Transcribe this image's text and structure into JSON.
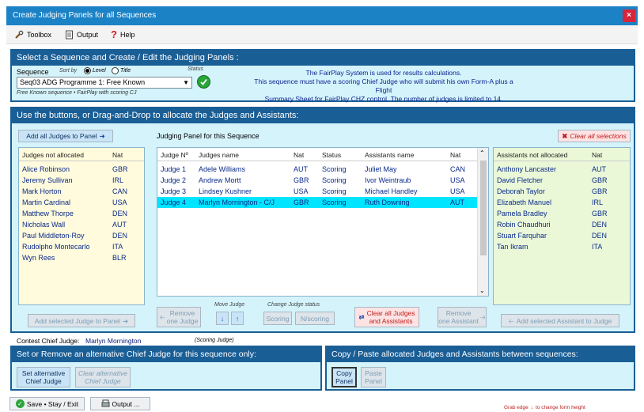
{
  "window": {
    "title": "Create Judging Panels for all Sequences",
    "close": "×"
  },
  "menu": [
    {
      "label": "Toolbox"
    },
    {
      "label": "Output"
    },
    {
      "label": "Help"
    }
  ],
  "sequence_section": {
    "title": "Select a Sequence and Create / Edit the Judging Panels :",
    "sequence_label": "Sequence",
    "sort_by": "Sort by",
    "sort_level": "Level",
    "sort_title": "Title",
    "status_label": "Status",
    "selected_sequence": "Seq03  ADG  Programme 1: Free Known",
    "note": "Free Known sequence  •  FairPlay with scoring CJ",
    "info_lines": [
      "The FairPlay System is used for results calculations.",
      "This sequence must have a scoring Chief Judge who will submit his own Form-A plus a Flight",
      "Summary Sheet for FairPlay CHZ control.  The number of judges is limited to 14."
    ]
  },
  "allocate_section": {
    "title": "Use the buttons, or Drag-and-Drop to allocate the Judges and Assistants:",
    "add_all_judges": "Add all Judges to Panel",
    "panel_title": "Judging Panel for this Sequence",
    "clear_all_selections": "Clear all selections",
    "judges_not_allocated": {
      "headers": [
        "Judges not allocated",
        "Nat"
      ],
      "rows": [
        [
          "Alice Robinson",
          "GBR"
        ],
        [
          "Jeremy Sullivan",
          "IRL"
        ],
        [
          "Mark Horton",
          "CAN"
        ],
        [
          "Martin Cardinal",
          "USA"
        ],
        [
          "Matthew Thorpe",
          "DEN"
        ],
        [
          "Nicholas Wall",
          "AUT"
        ],
        [
          "Paul Middleton-Roy",
          "DEN"
        ],
        [
          "Rudolpho Montecarlo",
          "ITA"
        ],
        [
          "Wyn Rees",
          "BLR"
        ]
      ]
    },
    "panel": {
      "headers": [
        "Judge Nº",
        "Judges name",
        "Nat",
        "Status",
        "Assistants name",
        "Nat"
      ],
      "rows": [
        [
          "Judge 1",
          "Adele Williams",
          "AUT",
          "Scoring",
          "Juliet May",
          "CAN"
        ],
        [
          "Judge 2",
          "Andrew Mortt",
          "GBR",
          "Scoring",
          "Ivor Weintraub",
          "USA"
        ],
        [
          "Judge 3",
          "Lindsey Kushner",
          "USA",
          "Scoring",
          "Michael Handley",
          "USA"
        ],
        [
          "Judge 4",
          "Marlyn Mornington - C/J",
          "GBR",
          "Scoring",
          "Ruth Downing",
          "AUT"
        ]
      ]
    },
    "assistants_not_allocated": {
      "headers": [
        "Assistants not allocated",
        "Nat"
      ],
      "rows": [
        [
          "Anthony Lancaster",
          "AUT"
        ],
        [
          "David Fletcher",
          "GBR"
        ],
        [
          "Deborah Taylor",
          "GBR"
        ],
        [
          "Elizabeth Manuel",
          "IRL"
        ],
        [
          "Pamela Bradley",
          "GBR"
        ],
        [
          "Robin Chaudhuri",
          "DEN"
        ],
        [
          "Stuart Farquhar",
          "DEN"
        ],
        [
          "Tan Ikram",
          "ITA"
        ]
      ]
    },
    "remove_judge": "Remove\none Judge",
    "move_judge": "Move Judge",
    "change_status": "Change Judge status",
    "scoring": "Scoring",
    "nscoring": "N/scoring",
    "clear_all_judges": "Clear all Judges\nand Assistants",
    "remove_assistant": "Remove\none Assistant",
    "add_selected_judge": "Add selected Judge to Panel",
    "add_selected_assistant": "Add selected Assistant to Judge"
  },
  "contest_chief": {
    "label": "Contest Chief Judge:",
    "name": "Marlyn Mornington",
    "note": "(Scoring Judge)"
  },
  "alt_chief": {
    "title": "Set or Remove an alternative Chief Judge for this sequence only:",
    "set": "Set alternative\nChief Judge",
    "clear": "Clear alternative\nChief Judge"
  },
  "copy_paste": {
    "title": "Copy / Paste allocated Judges and Assistants between sequences:",
    "copy": "Copy\nPanel",
    "paste": "Paste\nPanel"
  },
  "footer": {
    "save": "Save • Stay / Exit",
    "output": "Output ...",
    "grab_edge": "Grab edge",
    "resize_hint": "to change form height"
  },
  "colors": {
    "title_bar": "#1b82c6",
    "section_header": "#1a5e96",
    "selected_row": "#00e5ff"
  }
}
